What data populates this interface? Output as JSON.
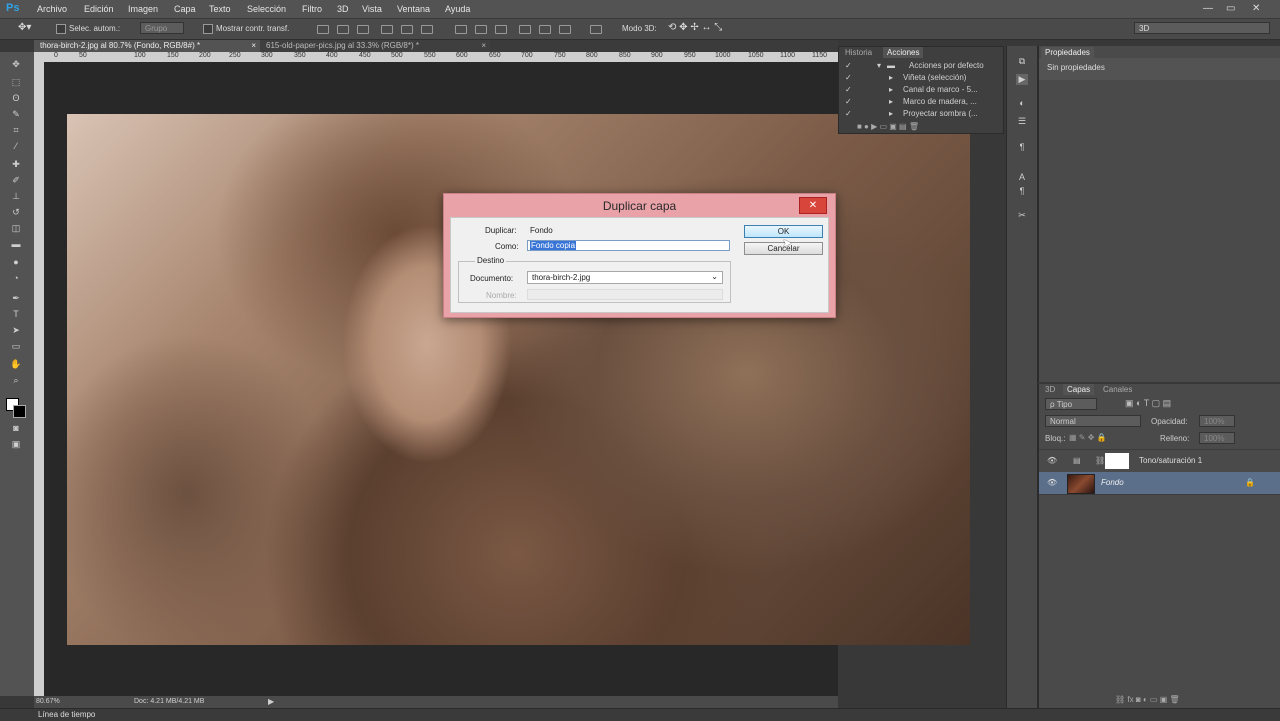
{
  "app": {
    "logo": "Ps"
  },
  "menu": [
    "Archivo",
    "Edición",
    "Imagen",
    "Capa",
    "Texto",
    "Selección",
    "Filtro",
    "3D",
    "Vista",
    "Ventana",
    "Ayuda"
  ],
  "window_controls": {
    "minimize": "—",
    "maximize": "▭",
    "close": "✕"
  },
  "options": {
    "auto_select_label": "Selec. autom.:",
    "auto_select_value": "Grupo",
    "show_transform_label": "Mostrar contr. transf.",
    "mode3d_label": "Modo 3D:",
    "workspace": "3D"
  },
  "tabs": [
    {
      "label": "thora-birch-2.jpg al 80.7% (Fondo, RGB/8#) *",
      "close": "×"
    },
    {
      "label": "615-old-paper-pics.jpg al 33.3% (RGB/8*) *",
      "close": "×"
    }
  ],
  "ruler_ticks": [
    "0",
    "50",
    "100",
    "150",
    "200",
    "250",
    "300",
    "350",
    "400",
    "450",
    "500",
    "550",
    "600",
    "650",
    "700",
    "750",
    "800",
    "850",
    "900",
    "950",
    "1000",
    "1050",
    "1100",
    "1150"
  ],
  "status": {
    "zoom": "80.67%",
    "doc": "Doc: 4.21 MB/4.21 MB"
  },
  "timeline": {
    "label": "Línea de tiempo"
  },
  "history_panel": {
    "tabs": [
      "Historia",
      "Acciones"
    ],
    "actions": [
      {
        "label": "Acciones por defecto",
        "folder": true
      },
      {
        "label": "Viñeta (selección)"
      },
      {
        "label": "Canal de marco - 5..."
      },
      {
        "label": "Marco de madera, ..."
      },
      {
        "label": "Proyectar sombra (..."
      }
    ]
  },
  "properties_panel": {
    "tab": "Propiedades",
    "empty_text": "Sin propiedades"
  },
  "layers_panel": {
    "tabs": [
      "3D",
      "Capas",
      "Canales"
    ],
    "filter_label": "ρ Tipo",
    "blend_mode": "Normal",
    "opacity_label": "Opacidad:",
    "opacity_value": "100%",
    "lock_label": "Bloq.:",
    "fill_label": "Relleno:",
    "fill_value": "100%",
    "layers": [
      {
        "name": "Tono/saturación 1",
        "type": "adjustment",
        "selected": false
      },
      {
        "name": "Fondo",
        "type": "image",
        "selected": true
      }
    ]
  },
  "dialog": {
    "title": "Duplicar capa",
    "close": "✕",
    "duplicate_label": "Duplicar:",
    "duplicate_value": "Fondo",
    "as_label": "Como:",
    "as_value": "Fondo copia",
    "destination_label": "Destino",
    "document_label": "Documento:",
    "document_value": "thora-birch-2.jpg",
    "name_label": "Nombre:",
    "ok": "OK",
    "cancel": "Cancelar"
  },
  "colors": {
    "accent": "#2fa3e6",
    "dialog_frame": "#e8a2a8",
    "selected_layer": "#5b6f8a"
  }
}
